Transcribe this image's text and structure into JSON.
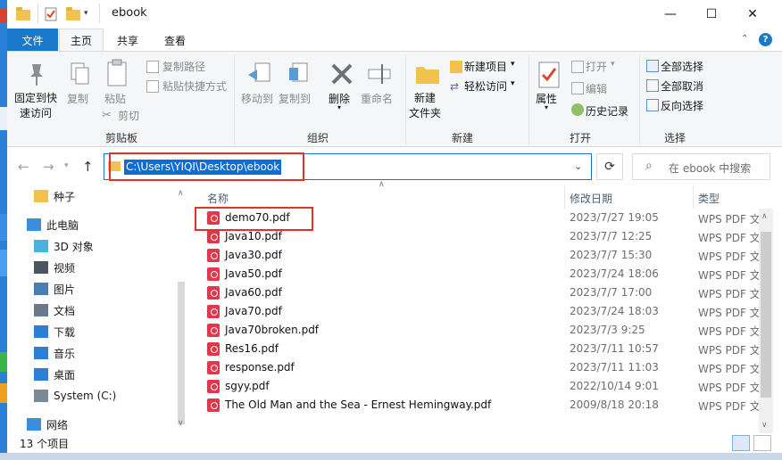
{
  "window": {
    "title": "ebook",
    "controls": {
      "minimize": "—",
      "maximize": "☐",
      "close": "✕"
    }
  },
  "tabs": [
    "文件",
    "主页",
    "共享",
    "查看"
  ],
  "ribbon": {
    "clipboard": {
      "label": "剪贴板",
      "pin": "固定到快\n速访问",
      "copy": "复制",
      "paste": "粘贴",
      "copy_path": "复制路径",
      "paste_shortcut": "粘贴快捷方式",
      "cut": "剪切"
    },
    "organize": {
      "label": "组织",
      "move_to": "移动到",
      "copy_to": "复制到",
      "delete": "删除",
      "rename": "重命名"
    },
    "new": {
      "label": "新建",
      "new_folder": "新建\n文件夹",
      "new_item": "新建项目",
      "easy_access": "轻松访问"
    },
    "open": {
      "label": "打开",
      "properties": "属性",
      "open": "打开",
      "edit": "编辑",
      "history": "历史记录"
    },
    "select": {
      "label": "选择",
      "select_all": "全部选择",
      "select_none": "全部取消",
      "invert": "反向选择"
    }
  },
  "address": {
    "path": "C:\\Users\\YIQI\\Desktop\\ebook",
    "search_placeholder": "在 ebook 中搜索"
  },
  "nav": [
    {
      "label": "种子",
      "icon": "folder-icon"
    },
    {
      "label": "此电脑",
      "icon": "computer-icon"
    },
    {
      "label": "3D 对象",
      "icon": "3d-objects-icon"
    },
    {
      "label": "视频",
      "icon": "video-icon"
    },
    {
      "label": "图片",
      "icon": "pictures-icon"
    },
    {
      "label": "文档",
      "icon": "documents-icon"
    },
    {
      "label": "下载",
      "icon": "download-icon"
    },
    {
      "label": "音乐",
      "icon": "music-icon"
    },
    {
      "label": "桌面",
      "icon": "desktop-icon"
    },
    {
      "label": "System (C:)",
      "icon": "drive-icon"
    },
    {
      "label": "网络",
      "icon": "network-icon"
    }
  ],
  "columns": {
    "name": "名称",
    "date": "修改日期",
    "type": "类型"
  },
  "files": [
    {
      "name": "demo70.pdf",
      "date": "2023/7/27 19:05",
      "type": "WPS PDF 文"
    },
    {
      "name": "Java10.pdf",
      "date": "2023/7/7 12:25",
      "type": "WPS PDF 文"
    },
    {
      "name": "Java30.pdf",
      "date": "2023/7/7 15:30",
      "type": "WPS PDF 文"
    },
    {
      "name": "Java50.pdf",
      "date": "2023/7/24 18:06",
      "type": "WPS PDF 文"
    },
    {
      "name": "Java60.pdf",
      "date": "2023/7/7 17:00",
      "type": "WPS PDF 文"
    },
    {
      "name": "Java70.pdf",
      "date": "2023/7/24 18:03",
      "type": "WPS PDF 文"
    },
    {
      "name": "Java70broken.pdf",
      "date": "2023/7/3 9:25",
      "type": "WPS PDF 文"
    },
    {
      "name": "Res16.pdf",
      "date": "2023/7/11 10:57",
      "type": "WPS PDF 文"
    },
    {
      "name": "response.pdf",
      "date": "2023/7/11 11:03",
      "type": "WPS PDF 文"
    },
    {
      "name": "sgyy.pdf",
      "date": "2022/10/14 9:01",
      "type": "WPS PDF 文"
    },
    {
      "name": "The Old Man and the Sea - Ernest Hemingway.pdf",
      "date": "2009/8/18 20:18",
      "type": "WPS PDF 文"
    }
  ],
  "status": {
    "count": "13 个项目"
  },
  "colors": {
    "accent": "#1979ca",
    "highlight_red": "#e0312b",
    "pdf_red": "#e2364a",
    "selection": "#0d6dd6"
  }
}
